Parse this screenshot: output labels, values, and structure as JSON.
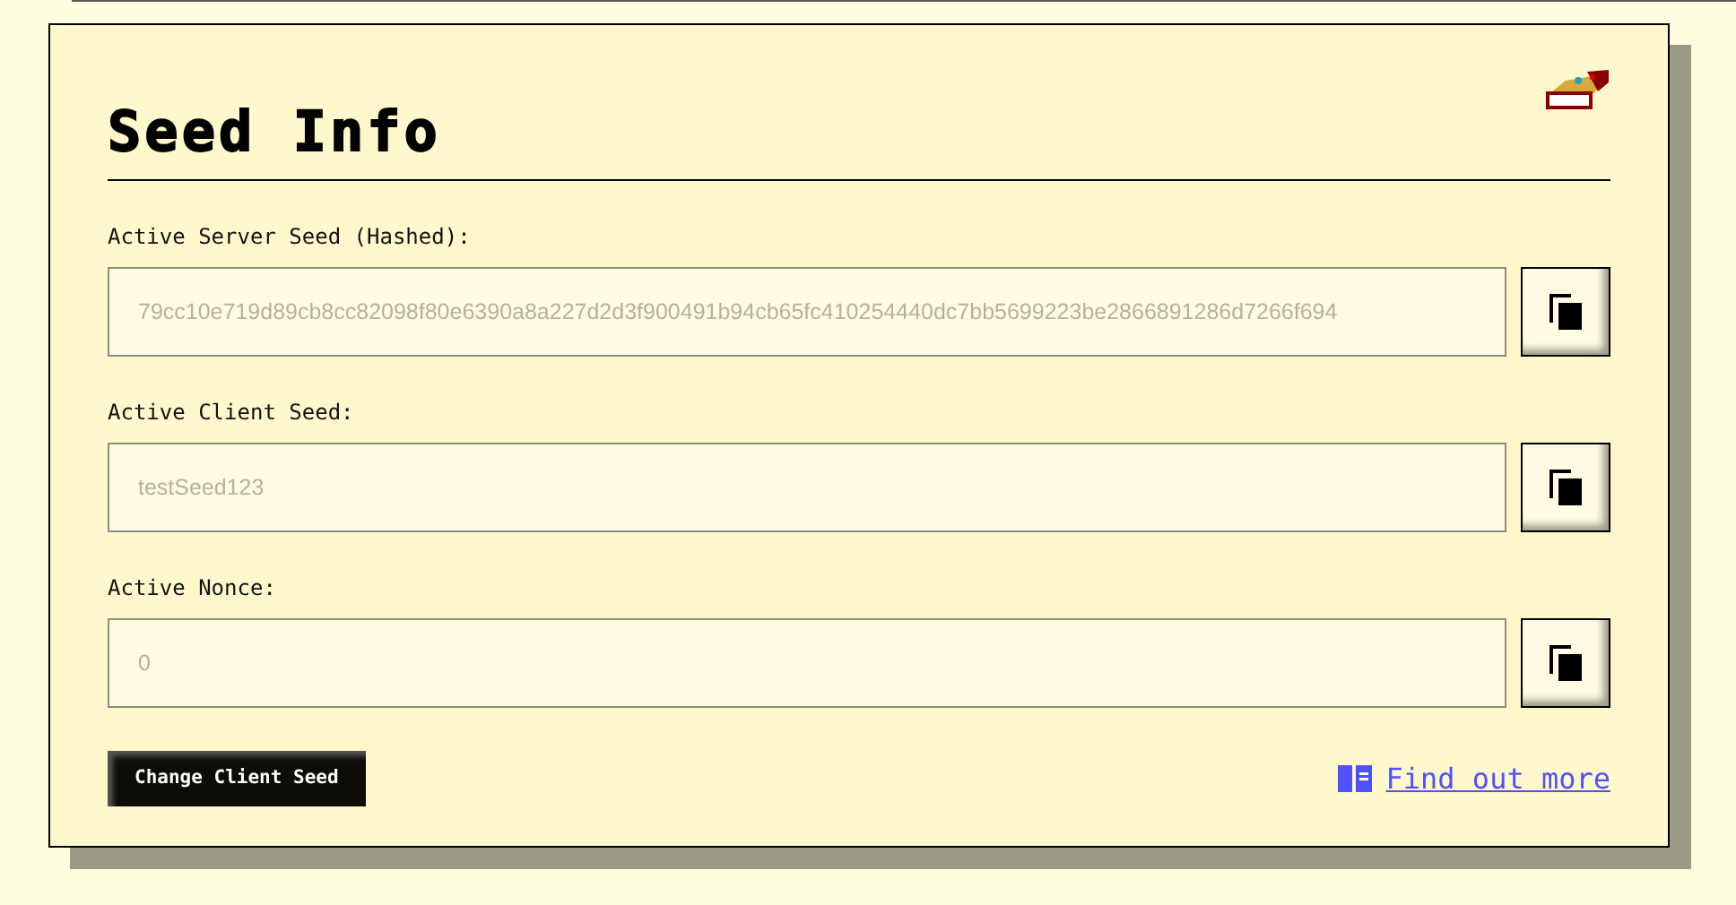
{
  "card": {
    "title": "Seed Info"
  },
  "fields": [
    {
      "label": "Active Server Seed (Hashed):",
      "value": "79cc10e719d89cb8cc82098f80e6390a8a227d2d3f900491b94cb65fc410254440dc7bb5699223be2866891286d7266f694"
    },
    {
      "label": "Active Client Seed:",
      "value": "testSeed123"
    },
    {
      "label": "Active Nonce:",
      "value": "0"
    }
  ],
  "primary_button": "Change Client Seed",
  "link": "Find out more"
}
